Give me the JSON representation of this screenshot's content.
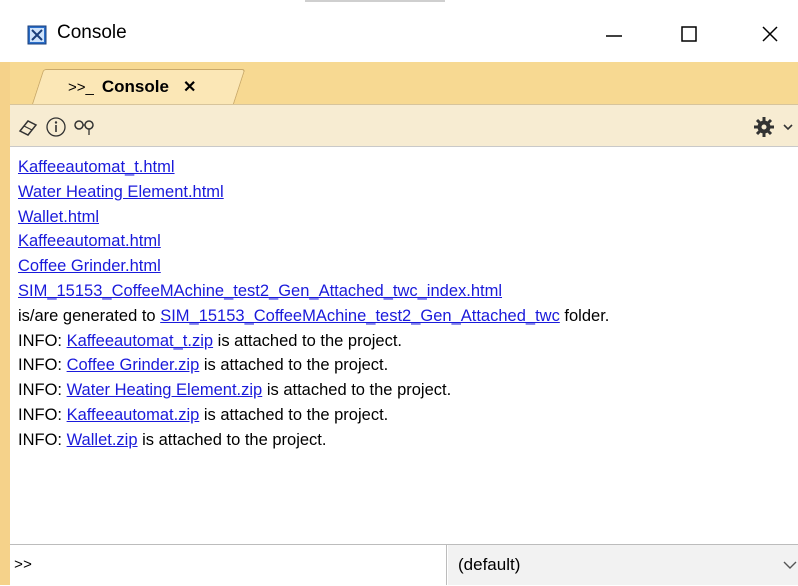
{
  "window": {
    "title": "Console",
    "icon": "console-app-icon",
    "controls": [
      "minimize-icon",
      "maximize-icon",
      "close-icon"
    ]
  },
  "tab": {
    "prefix": ">>_",
    "label": "Console",
    "close": "✕"
  },
  "toolbar": {
    "icons": [
      "eraser-icon",
      "info-icon",
      "find-icon",
      "gear-icon",
      "dropdown-arrow-icon"
    ]
  },
  "output": {
    "lines": [
      {
        "parts": [
          {
            "text": "Kaffeeautomat_t.html",
            "link": true
          }
        ]
      },
      {
        "parts": [
          {
            "text": "Water Heating Element.html",
            "link": true
          }
        ]
      },
      {
        "parts": [
          {
            "text": "Wallet.html",
            "link": true
          }
        ]
      },
      {
        "parts": [
          {
            "text": "Kaffeeautomat.html",
            "link": true
          }
        ]
      },
      {
        "parts": [
          {
            "text": "Coffee Grinder.html",
            "link": true
          }
        ]
      },
      {
        "parts": [
          {
            "text": "SIM_15153_CoffeeMAchine_test2_Gen_Attached_twc_index.html",
            "link": true
          }
        ]
      },
      {
        "parts": [
          {
            "text": "is/are generated to ",
            "link": false
          },
          {
            "text": "SIM_15153_CoffeeMAchine_test2_Gen_Attached_twc",
            "link": true
          },
          {
            "text": " folder.",
            "link": false
          }
        ]
      },
      {
        "parts": [
          {
            "text": "INFO: ",
            "link": false
          },
          {
            "text": "Kaffeeautomat_t.zip",
            "link": true
          },
          {
            "text": " is attached to the project.",
            "link": false
          }
        ]
      },
      {
        "parts": [
          {
            "text": "INFO: ",
            "link": false
          },
          {
            "text": "Coffee Grinder.zip",
            "link": true
          },
          {
            "text": " is attached to the project.",
            "link": false
          }
        ]
      },
      {
        "parts": [
          {
            "text": "INFO: ",
            "link": false
          },
          {
            "text": "Water Heating Element.zip",
            "link": true
          },
          {
            "text": " is attached to the project.",
            "link": false
          }
        ]
      },
      {
        "parts": [
          {
            "text": "INFO: ",
            "link": false
          },
          {
            "text": "Kaffeeautomat.zip",
            "link": true
          },
          {
            "text": " is attached to the project.",
            "link": false
          }
        ]
      },
      {
        "parts": [
          {
            "text": "INFO: ",
            "link": false
          },
          {
            "text": "Wallet.zip",
            "link": true
          },
          {
            "text": " is attached to the project.",
            "link": false
          }
        ]
      }
    ]
  },
  "command": {
    "value": ">>",
    "selected_option": "(default)"
  },
  "colors": {
    "link": "#1a1adb",
    "panel": "#f7d992",
    "tab": "#fbe7b6",
    "toolbar": "#f7ecd2"
  }
}
